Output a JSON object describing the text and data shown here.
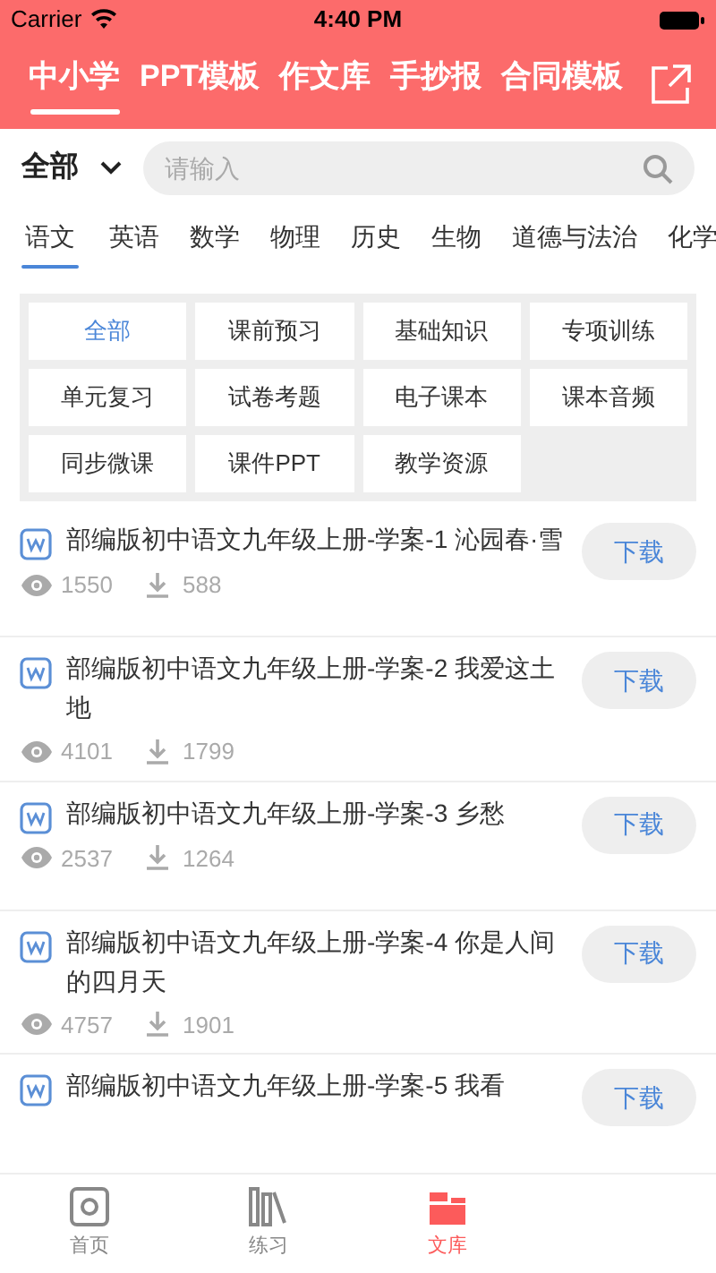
{
  "status_bar": {
    "carrier": "Carrier",
    "time": "4:40 PM"
  },
  "top_tabs": [
    {
      "label": "中小学",
      "selected": true
    },
    {
      "label": "PPT模板",
      "selected": false
    },
    {
      "label": "作文库",
      "selected": false
    },
    {
      "label": "手抄报",
      "selected": false
    },
    {
      "label": "合同模板",
      "selected": false
    }
  ],
  "filter": {
    "scope": "全部",
    "placeholder": "请输入"
  },
  "subjects": [
    {
      "label": "语文",
      "selected": true
    },
    {
      "label": "英语",
      "selected": false
    },
    {
      "label": "数学",
      "selected": false
    },
    {
      "label": "物理",
      "selected": false
    },
    {
      "label": "历史",
      "selected": false
    },
    {
      "label": "生物",
      "selected": false
    },
    {
      "label": "道德与法治",
      "selected": false
    },
    {
      "label": "化学",
      "selected": false
    }
  ],
  "categories": [
    {
      "label": "全部",
      "selected": true
    },
    {
      "label": "课前预习",
      "selected": false
    },
    {
      "label": "基础知识",
      "selected": false
    },
    {
      "label": "专项训练",
      "selected": false
    },
    {
      "label": "单元复习",
      "selected": false
    },
    {
      "label": "试卷考题",
      "selected": false
    },
    {
      "label": "电子课本",
      "selected": false
    },
    {
      "label": "课本音频",
      "selected": false
    },
    {
      "label": "同步微课",
      "selected": false
    },
    {
      "label": "课件PPT",
      "selected": false
    },
    {
      "label": "教学资源",
      "selected": false
    }
  ],
  "documents": [
    {
      "title": "部编版初中语文九年级上册-学案-1 沁园春·雪",
      "views": "1550",
      "downloads": "588",
      "button": "下载"
    },
    {
      "title": "部编版初中语文九年级上册-学案-2 我爱这土地",
      "views": "4101",
      "downloads": "1799",
      "button": "下载"
    },
    {
      "title": "部编版初中语文九年级上册-学案-3 乡愁",
      "views": "2537",
      "downloads": "1264",
      "button": "下载"
    },
    {
      "title": "部编版初中语文九年级上册-学案-4 你是人间的四月天",
      "views": "4757",
      "downloads": "1901",
      "button": "下载"
    },
    {
      "title": "部编版初中语文九年级上册-学案-5 我看",
      "button": "下载"
    }
  ],
  "bottom_nav": [
    {
      "label": "首页",
      "kind": "home",
      "selected": false
    },
    {
      "label": "练习",
      "kind": "practice",
      "selected": false
    },
    {
      "label": "文库",
      "kind": "library",
      "selected": true
    }
  ]
}
